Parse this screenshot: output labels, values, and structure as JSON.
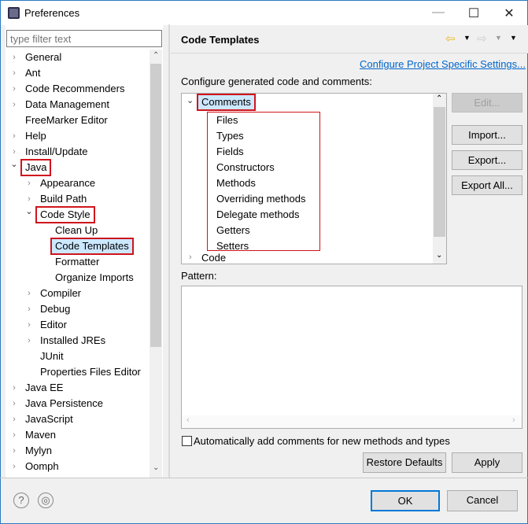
{
  "window": {
    "title": "Preferences",
    "minimize": "—",
    "maximize": "☐",
    "close": "✕"
  },
  "filter": {
    "placeholder": "type filter text"
  },
  "nav": [
    {
      "label": "General",
      "level": 0,
      "state": "collapsed"
    },
    {
      "label": "Ant",
      "level": 0,
      "state": "collapsed"
    },
    {
      "label": "Code Recommenders",
      "level": 0,
      "state": "collapsed"
    },
    {
      "label": "Data Management",
      "level": 0,
      "state": "collapsed"
    },
    {
      "label": "FreeMarker Editor",
      "level": 0,
      "state": "leaf"
    },
    {
      "label": "Help",
      "level": 0,
      "state": "collapsed"
    },
    {
      "label": "Install/Update",
      "level": 0,
      "state": "collapsed"
    },
    {
      "label": "Java",
      "level": 0,
      "state": "expanded",
      "highlight": true
    },
    {
      "label": "Appearance",
      "level": 1,
      "state": "collapsed"
    },
    {
      "label": "Build Path",
      "level": 1,
      "state": "collapsed"
    },
    {
      "label": "Code Style",
      "level": 1,
      "state": "expanded",
      "highlight": true
    },
    {
      "label": "Clean Up",
      "level": 2,
      "state": "leaf"
    },
    {
      "label": "Code Templates",
      "level": 2,
      "state": "leaf",
      "selected": true,
      "highlight": true
    },
    {
      "label": "Formatter",
      "level": 2,
      "state": "leaf"
    },
    {
      "label": "Organize Imports",
      "level": 2,
      "state": "leaf"
    },
    {
      "label": "Compiler",
      "level": 1,
      "state": "collapsed"
    },
    {
      "label": "Debug",
      "level": 1,
      "state": "collapsed"
    },
    {
      "label": "Editor",
      "level": 1,
      "state": "collapsed"
    },
    {
      "label": "Installed JREs",
      "level": 1,
      "state": "collapsed"
    },
    {
      "label": "JUnit",
      "level": 1,
      "state": "leaf"
    },
    {
      "label": "Properties Files Editor",
      "level": 1,
      "state": "leaf"
    },
    {
      "label": "Java EE",
      "level": 0,
      "state": "collapsed"
    },
    {
      "label": "Java Persistence",
      "level": 0,
      "state": "collapsed"
    },
    {
      "label": "JavaScript",
      "level": 0,
      "state": "collapsed"
    },
    {
      "label": "Maven",
      "level": 0,
      "state": "collapsed"
    },
    {
      "label": "Mylyn",
      "level": 0,
      "state": "collapsed"
    },
    {
      "label": "Oomph",
      "level": 0,
      "state": "collapsed"
    }
  ],
  "page": {
    "title": "Code Templates",
    "config_link": "Configure Project Specific Settings...",
    "config_label": "Configure generated code and comments:",
    "templates": {
      "comments": "Comments",
      "comment_children": [
        "Files",
        "Types",
        "Fields",
        "Constructors",
        "Methods",
        "Overriding methods",
        "Delegate methods",
        "Getters",
        "Setters"
      ],
      "code": "Code"
    },
    "buttons": {
      "edit": "Edit...",
      "import": "Import...",
      "export": "Export...",
      "export_all": "Export All..."
    },
    "pattern_label": "Pattern:",
    "auto_comments_label": "Automatically add comments for new methods and types",
    "auto_comments_checked": false,
    "restore_defaults": "Restore Defaults",
    "apply": "Apply"
  },
  "footer": {
    "ok": "OK",
    "cancel": "Cancel",
    "help_icon": "?",
    "import_icon": "◎"
  },
  "colors": {
    "selection": "#cce8ff",
    "annotation": "#d0141c",
    "link": "#0066cc",
    "back_arrow": "#e8b830"
  }
}
